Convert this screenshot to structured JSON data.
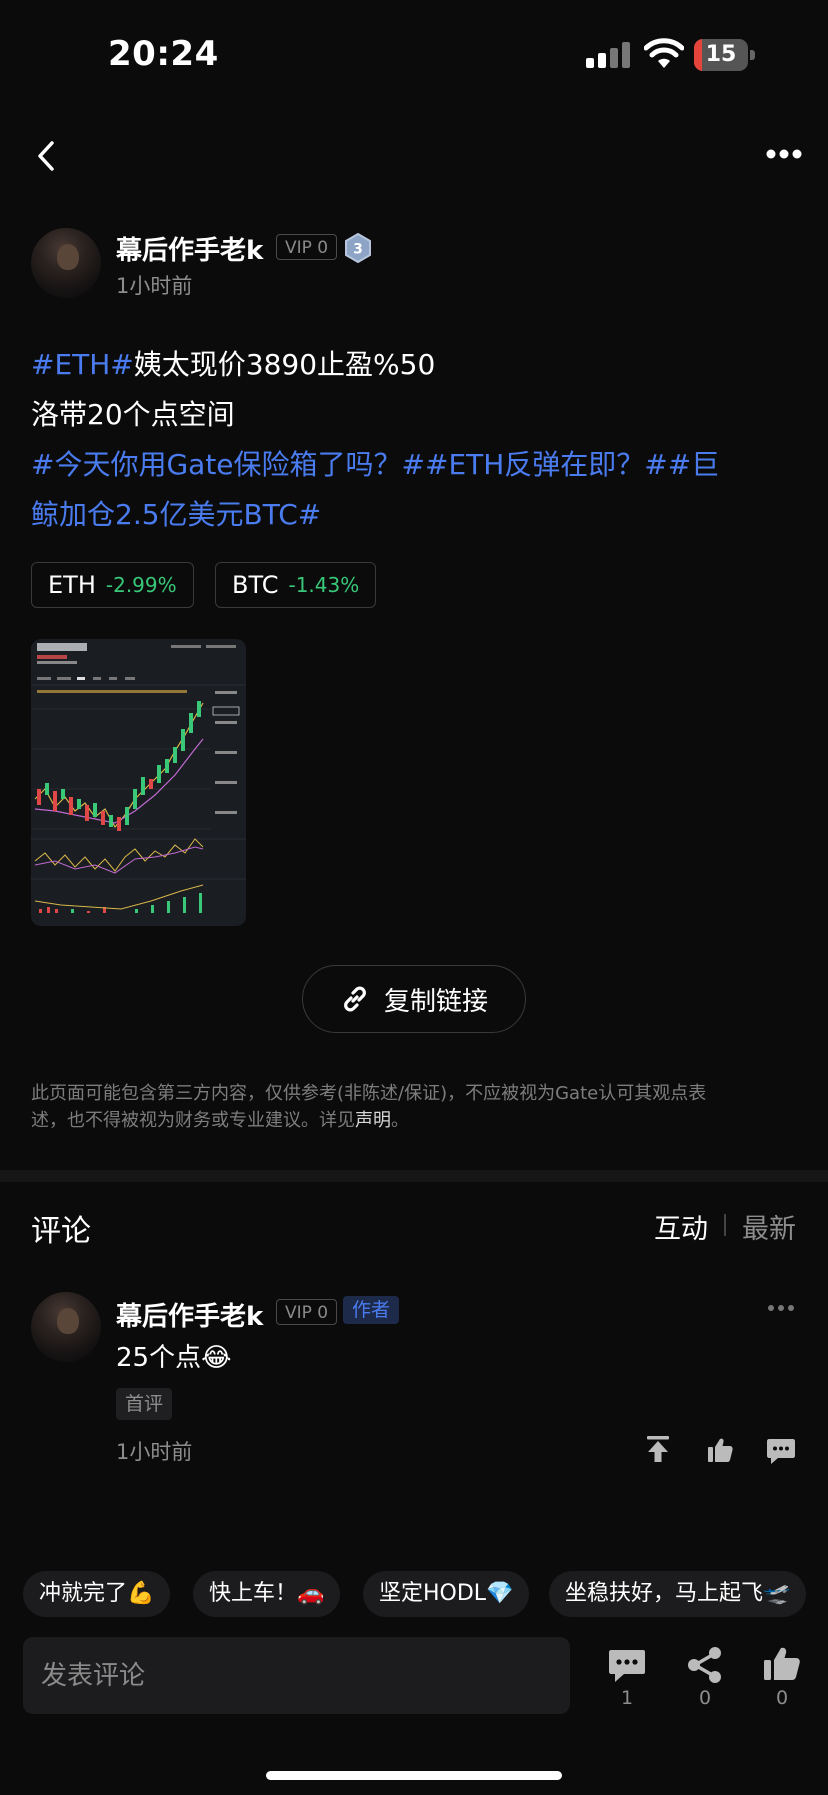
{
  "status_bar": {
    "time": "20:24",
    "battery": "15",
    "battery_level": 0.15
  },
  "author": {
    "name": "幕后作手老k",
    "vip": "VIP 0",
    "level": "3",
    "posted": "1小时前"
  },
  "post": {
    "line1_tag": "#ETH#",
    "line1_text": "姨太现价3890止盈%50",
    "line2_text": "洛带20个点空间",
    "line3_link": "#今天你用Gate保险箱了吗？##ETH反弹在即？##巨",
    "line4_link": "鲸加仓2.5亿美元BTC#",
    "tickers": [
      {
        "symbol": "ETH",
        "change": "-2.99%"
      },
      {
        "symbol": "BTC",
        "change": "-1.43%"
      }
    ]
  },
  "copy_link_label": "复制链接",
  "disclaimer": {
    "text1": "此页面可能包含第三方内容，仅供参考(非陈述/保证)，不应被视为Gate认可其观点表",
    "text2": "述，也不得被视为财务或专业建议。详见",
    "link": "声明",
    "end": "。"
  },
  "comments": {
    "title": "评论",
    "sort_options": [
      "互动",
      "最新"
    ],
    "items": [
      {
        "name": "幕后作手老k",
        "vip": "VIP 0",
        "author_tag": "作者",
        "text": "25个点😂",
        "badge": "首评",
        "time": "1小时前"
      }
    ]
  },
  "quick_replies": [
    "冲就完了💪",
    "快上车！🚗",
    "坚定HODL💎",
    "坐稳扶好，马上起飞🛫"
  ],
  "composer": {
    "placeholder": "发表评论",
    "comment_count": "1",
    "share_count": "0",
    "like_count": "0"
  },
  "colors": {
    "link": "#4a7cf0",
    "positive_text": "#38c878",
    "background": "#0b0b0c"
  },
  "icons": [
    "back-icon",
    "more-icon",
    "link-icon",
    "pin-icon",
    "thumb-up-icon",
    "comment-icon",
    "share-icon"
  ]
}
